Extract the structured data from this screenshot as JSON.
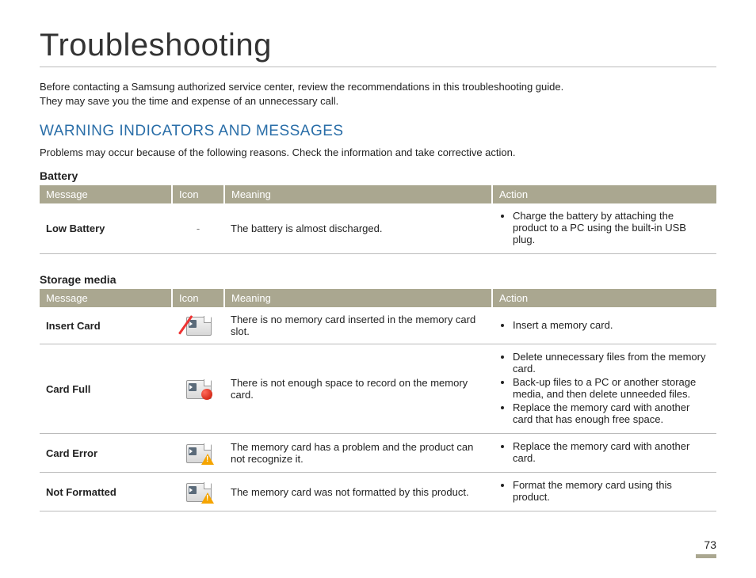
{
  "title": "Troubleshooting",
  "intro_line1": "Before contacting a Samsung authorized service center, review the recommendations in this troubleshooting guide.",
  "intro_line2": "They may save you the time and expense of an unnecessary call.",
  "section_heading": "WARNING INDICATORS AND MESSAGES",
  "section_text": "Problems may occur because of the following reasons. Check the information and take corrective action.",
  "headers": {
    "message": "Message",
    "icon": "Icon",
    "meaning": "Meaning",
    "action": "Action"
  },
  "battery": {
    "subhead": "Battery",
    "rows": [
      {
        "message": "Low Battery",
        "icon": "-",
        "meaning": "The battery is almost discharged.",
        "actions": [
          "Charge the battery by attaching the product to a PC using the built-in USB plug."
        ]
      }
    ]
  },
  "storage": {
    "subhead": "Storage media",
    "rows": [
      {
        "message": "Insert Card",
        "icon": "sd-slash",
        "meaning": "There is no memory card inserted in the memory card slot.",
        "actions": [
          "Insert a memory card."
        ]
      },
      {
        "message": "Card Full",
        "icon": "sd-full",
        "meaning": "There is not enough space to record on the memory card.",
        "actions": [
          "Delete unnecessary files from the memory card.",
          "Back-up files to a PC or another storage media, and then delete unneeded files.",
          "Replace the memory card with another card that has enough free space."
        ]
      },
      {
        "message": "Card Error",
        "icon": "sd-warn",
        "meaning": "The memory card has a problem and the product can not recognize it.",
        "actions": [
          "Replace the memory card with another card."
        ]
      },
      {
        "message": "Not Formatted",
        "icon": "sd-warn",
        "meaning": "The memory card was not formatted by this product.",
        "actions": [
          "Format the memory card using this product."
        ]
      }
    ]
  },
  "page_number": "73"
}
